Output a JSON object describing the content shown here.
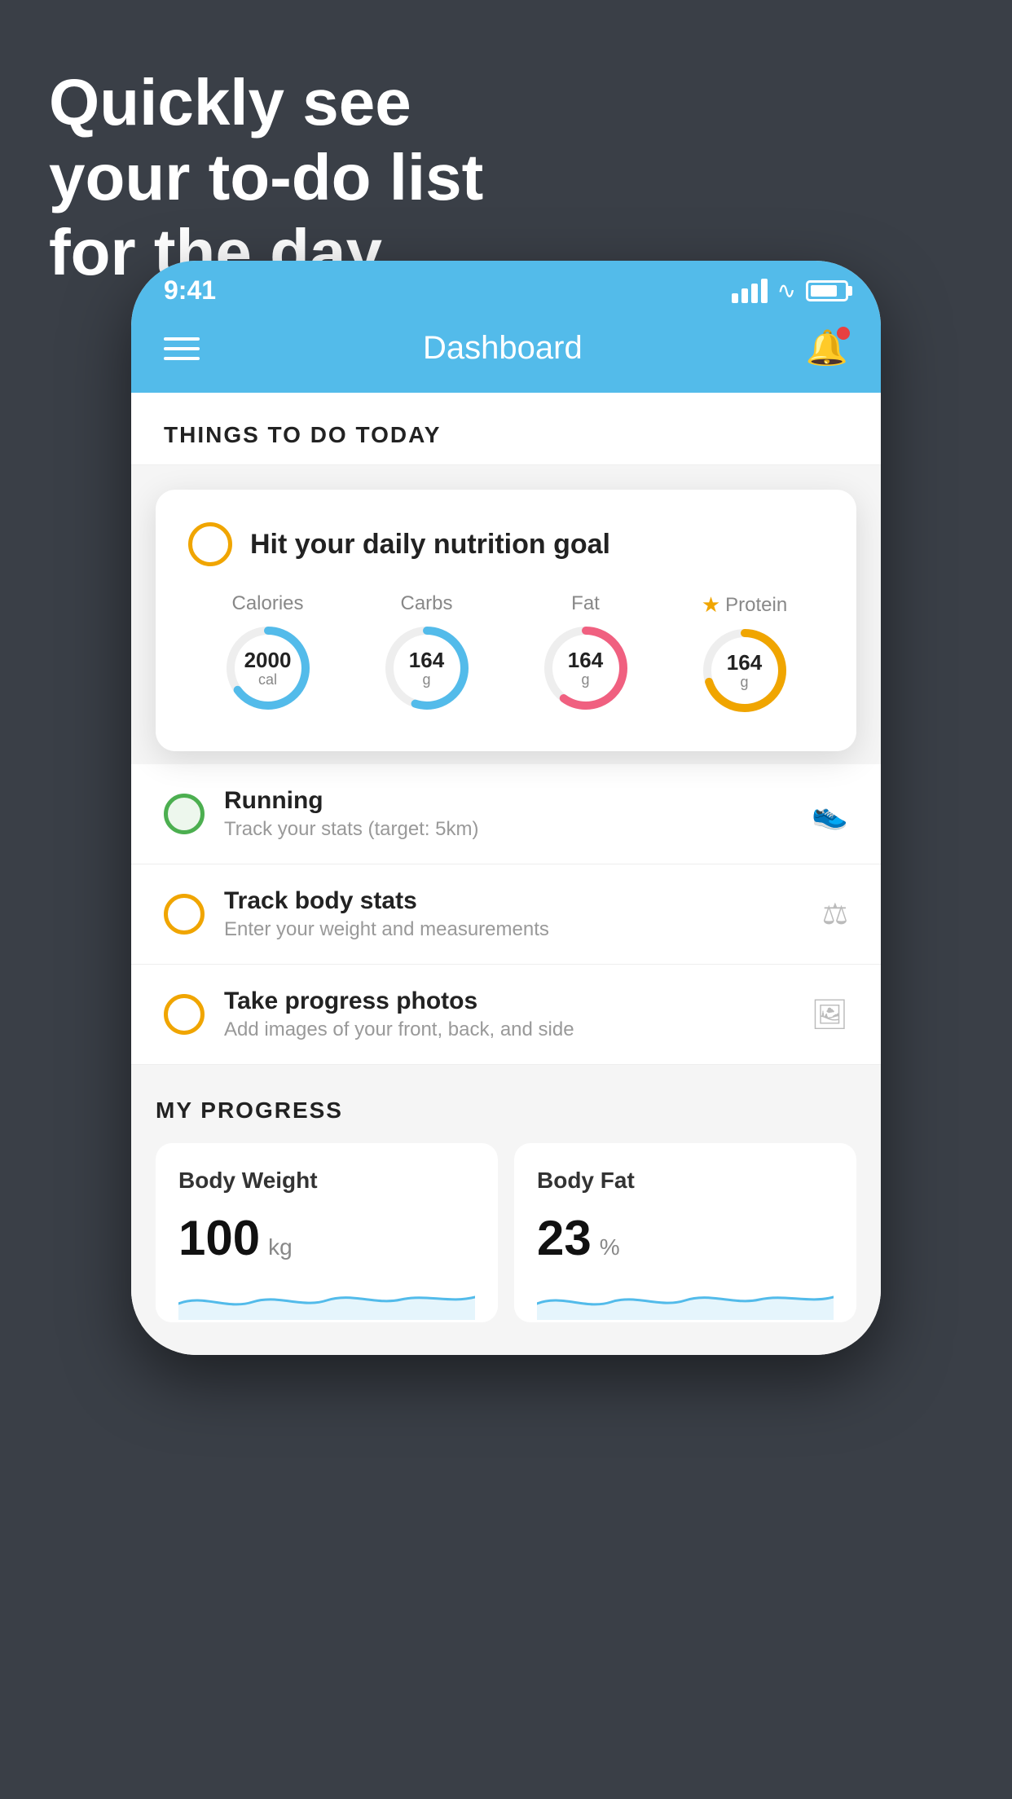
{
  "hero": {
    "line1": "Quickly see",
    "line2": "your to-do list",
    "line3": "for the day."
  },
  "status_bar": {
    "time": "9:41"
  },
  "nav": {
    "title": "Dashboard"
  },
  "things_today": {
    "header": "THINGS TO DO TODAY"
  },
  "nutrition_card": {
    "title": "Hit your daily nutrition goal",
    "items": [
      {
        "label": "Calories",
        "value": "2000",
        "unit": "cal",
        "color": "#53bbea",
        "track_pct": 65
      },
      {
        "label": "Carbs",
        "value": "164",
        "unit": "g",
        "color": "#53bbea",
        "track_pct": 55
      },
      {
        "label": "Fat",
        "value": "164",
        "unit": "g",
        "color": "#f06080",
        "track_pct": 60
      },
      {
        "label": "Protein",
        "value": "164",
        "unit": "g",
        "color": "#f0a500",
        "track_pct": 70,
        "starred": true
      }
    ]
  },
  "todo_items": [
    {
      "title": "Running",
      "subtitle": "Track your stats (target: 5km)",
      "circle_style": "green",
      "icon": "👟"
    },
    {
      "title": "Track body stats",
      "subtitle": "Enter your weight and measurements",
      "circle_style": "yellow",
      "icon": "⚖"
    },
    {
      "title": "Take progress photos",
      "subtitle": "Add images of your front, back, and side",
      "circle_style": "yellow",
      "icon": "🖼"
    }
  ],
  "progress": {
    "header": "MY PROGRESS",
    "cards": [
      {
        "title": "Body Weight",
        "value": "100",
        "unit": "kg"
      },
      {
        "title": "Body Fat",
        "value": "23",
        "unit": "%"
      }
    ]
  }
}
